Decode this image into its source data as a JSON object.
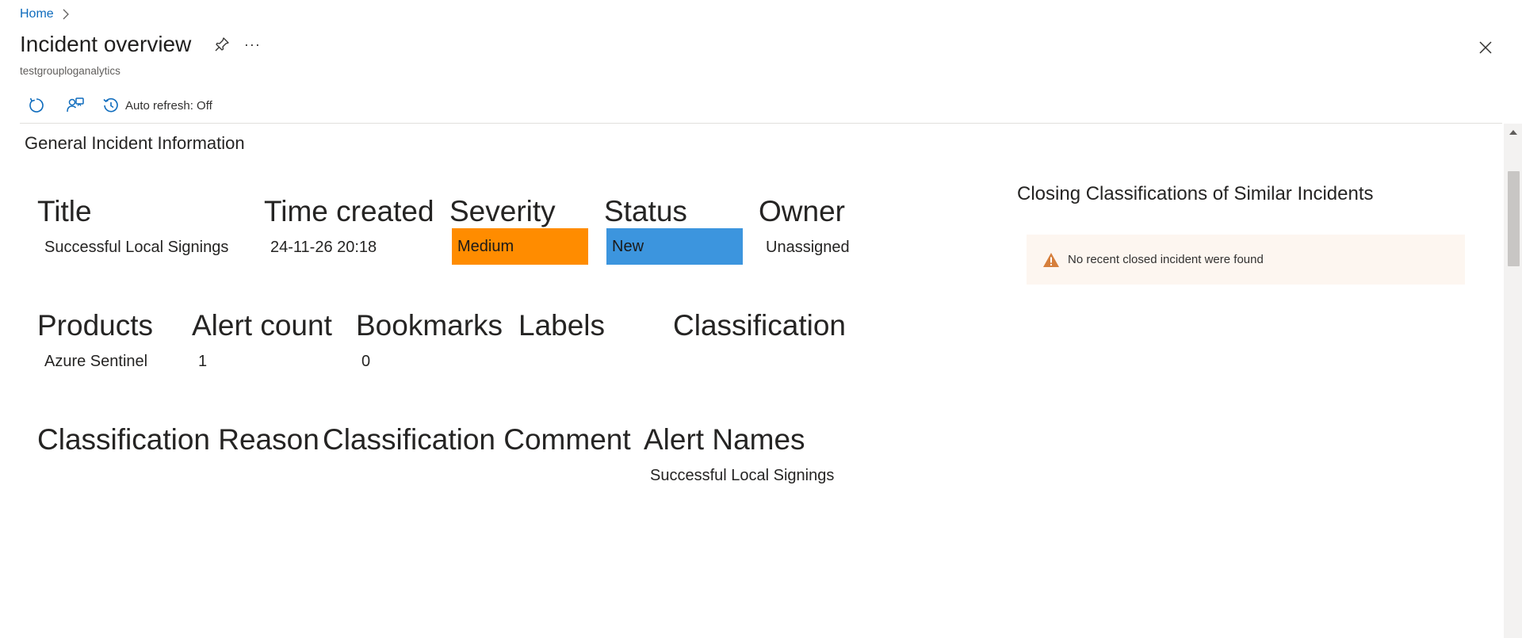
{
  "breadcrumb": {
    "home": "Home"
  },
  "header": {
    "title": "Incident overview",
    "subtitle": "testgrouploganalytics",
    "more_label": "···"
  },
  "toolbar": {
    "auto_refresh_label": "Auto refresh: Off"
  },
  "section": {
    "title": "General Incident Information"
  },
  "fields": {
    "title": {
      "label": "Title",
      "value": "Successful Local Signings"
    },
    "time_created": {
      "label": "Time created",
      "value": "24-11-26 20:18"
    },
    "severity": {
      "label": "Severity",
      "value": "Medium",
      "color": "#ff8c00"
    },
    "status": {
      "label": "Status",
      "value": "New",
      "color": "#3c95de"
    },
    "owner": {
      "label": "Owner",
      "value": "Unassigned"
    },
    "products": {
      "label": "Products",
      "value": "Azure Sentinel"
    },
    "alert_count": {
      "label": "Alert count",
      "value": "1"
    },
    "bookmarks": {
      "label": "Bookmarks",
      "value": "0"
    },
    "labels": {
      "label": "Labels",
      "value": ""
    },
    "classification": {
      "label": "Classification",
      "value": ""
    },
    "classification_reason": {
      "label": "Classification Reason",
      "value": ""
    },
    "classification_comment": {
      "label": "Classification Comment",
      "value": ""
    },
    "alert_names": {
      "label": "Alert Names",
      "value": "Successful Local Signings"
    }
  },
  "closing_panel": {
    "title": "Closing Classifications of Similar Incidents",
    "notice": "No recent closed incident were found",
    "notice_icon": "warning-icon",
    "warning_color": "#d67f3c"
  },
  "icons": {
    "breadcrumb_separator": "chevron-right-icon",
    "pin": "pin-icon",
    "more": "more-icon",
    "close": "close-icon",
    "refresh": "refresh-icon",
    "share": "share-icon",
    "auto_refresh": "history-icon"
  }
}
